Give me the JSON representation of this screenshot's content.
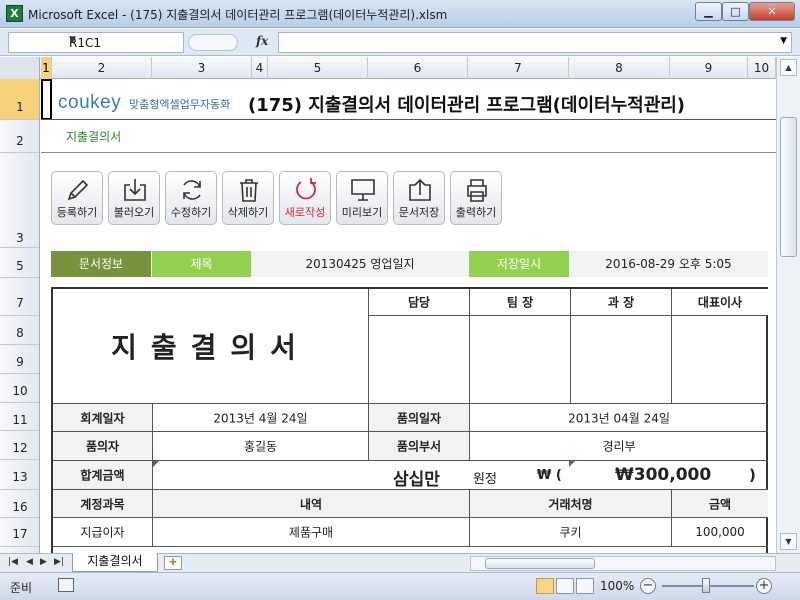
{
  "window": {
    "title": "Microsoft Excel - (175) 지출결의서 데이터관리 프로그램(데이터누적관리).xlsm",
    "min": "▁",
    "max": "□",
    "close": "✕"
  },
  "formula_bar": {
    "name_box": "R1C1",
    "fx": "fx",
    "formula": ""
  },
  "columns": [
    "1",
    "2",
    "3",
    "4",
    "5",
    "6",
    "7",
    "8",
    "9",
    "10"
  ],
  "rows": [
    "1",
    "2",
    "3",
    "5",
    "7",
    "8",
    "9",
    "10",
    "11",
    "12",
    "13",
    "16",
    "17"
  ],
  "sheet": {
    "brand": "coukey",
    "brand_tagline": "맞춤형엑셀업무자동화",
    "title": "(175) 지출결의서 데이터관리 프로그램(데이터누적관리)",
    "subtitle": "지출결의서"
  },
  "toolbar": {
    "register": "등록하기",
    "load": "불러오기",
    "edit": "수정하기",
    "delete": "삭제하기",
    "new": "새로작성",
    "preview": "미리보기",
    "save_doc": "문서저장",
    "print": "출력하기"
  },
  "info": {
    "doc_info_label": "문서정보",
    "subject_label": "제목",
    "subject_value": "20130425  영업일지",
    "saved_label": "저장일시",
    "saved_value": "2016-08-29   오후 5:05"
  },
  "form": {
    "title": "지출결의서",
    "approvals": [
      "담당",
      "팀 장",
      "과 장",
      "대표이사"
    ],
    "accounting_date_label": "회계일자",
    "accounting_date": "2013년  4월  24일",
    "request_date_label": "품의일자",
    "request_date": "2013년 04월 24일",
    "requester_label": "품의자",
    "requester": "홍길동",
    "dept_label": "품의부서",
    "dept": "경리부",
    "total_label": "합계금액",
    "total_korean": "삼십만",
    "won_label": "원정",
    "won_open": "₩ (",
    "total_amount": "₩300,000",
    "close_paren": ")",
    "headers": {
      "account": "계정과목",
      "description": "내역",
      "vendor": "거래처명",
      "amount": "금액"
    },
    "rows": [
      {
        "account": "지급이자",
        "description": "제품구매",
        "vendor": "쿠키",
        "amount": "100,000"
      }
    ]
  },
  "tabs": {
    "sheet_name": "지출결의서"
  },
  "status": {
    "ready": "준비",
    "zoom": "100%",
    "zoom_out": "−",
    "zoom_in": "+"
  }
}
